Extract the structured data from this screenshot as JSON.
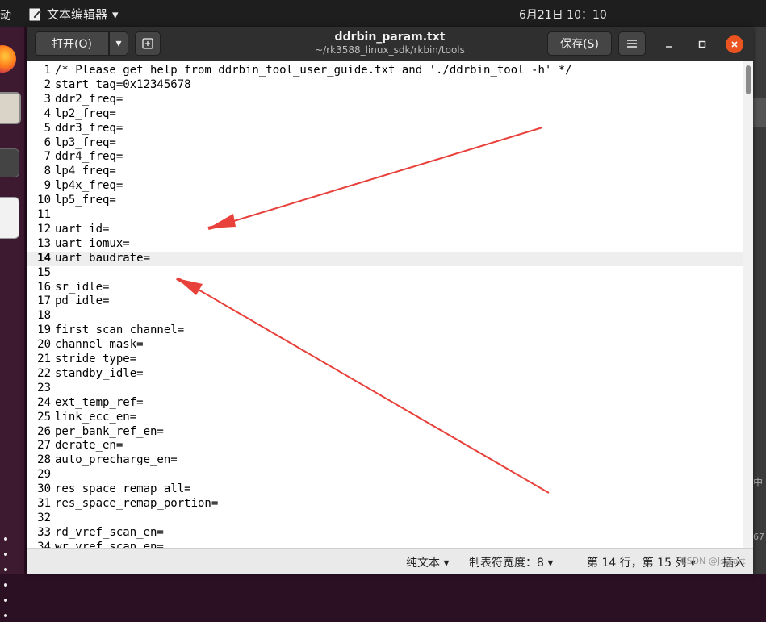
{
  "topbar": {
    "activities": "动",
    "app_name": "文本编辑器",
    "clock": "6月21日  10：10"
  },
  "window": {
    "open_label": "打开(O)",
    "title": "ddrbin_param.txt",
    "subtitle": "~/rk3588_linux_sdk/rkbin/tools",
    "save_label": "保存(S)"
  },
  "editor": {
    "current_line": 14,
    "lines": [
      {
        "n": "1",
        "text": "/* Please get help from ddrbin_tool_user_guide.txt and './ddrbin_tool -h' */"
      },
      {
        "n": "2",
        "text": "start tag=0x12345678"
      },
      {
        "n": "3",
        "text": "ddr2_freq="
      },
      {
        "n": "4",
        "text": "lp2_freq="
      },
      {
        "n": "5",
        "text": "ddr3_freq="
      },
      {
        "n": "6",
        "text": "lp3_freq="
      },
      {
        "n": "7",
        "text": "ddr4_freq="
      },
      {
        "n": "8",
        "text": "lp4_freq="
      },
      {
        "n": "9",
        "text": "lp4x_freq="
      },
      {
        "n": "10",
        "text": "lp5_freq="
      },
      {
        "n": "11",
        "text": ""
      },
      {
        "n": "12",
        "text": "uart id="
      },
      {
        "n": "13",
        "text": "uart iomux="
      },
      {
        "n": "14",
        "text": "uart baudrate="
      },
      {
        "n": "15",
        "text": ""
      },
      {
        "n": "16",
        "text": "sr_idle="
      },
      {
        "n": "17",
        "text": "pd_idle="
      },
      {
        "n": "18",
        "text": ""
      },
      {
        "n": "19",
        "text": "first scan channel="
      },
      {
        "n": "20",
        "text": "channel mask="
      },
      {
        "n": "21",
        "text": "stride type="
      },
      {
        "n": "22",
        "text": "standby_idle="
      },
      {
        "n": "23",
        "text": ""
      },
      {
        "n": "24",
        "text": "ext_temp_ref="
      },
      {
        "n": "25",
        "text": "link_ecc_en="
      },
      {
        "n": "26",
        "text": "per_bank_ref_en="
      },
      {
        "n": "27",
        "text": "derate_en="
      },
      {
        "n": "28",
        "text": "auto_precharge_en="
      },
      {
        "n": "29",
        "text": ""
      },
      {
        "n": "30",
        "text": "res_space_remap_all="
      },
      {
        "n": "31",
        "text": "res_space_remap_portion="
      },
      {
        "n": "32",
        "text": ""
      },
      {
        "n": "33",
        "text": "rd_vref_scan_en="
      },
      {
        "n": "34",
        "text": "wr_vref_scan_en="
      }
    ]
  },
  "status": {
    "language": "纯文本 ▾",
    "tab_width": "制表符宽度：8 ▾",
    "position": "第 14 行，第 15 列 ▾",
    "insert_mode": "插入"
  },
  "watermark": "CSDN @Jsstart",
  "side_right": {
    "glyph1": "中",
    "glyph2": "67"
  },
  "colors": {
    "accent_close": "#e95420",
    "arrow": "#e8403a"
  }
}
